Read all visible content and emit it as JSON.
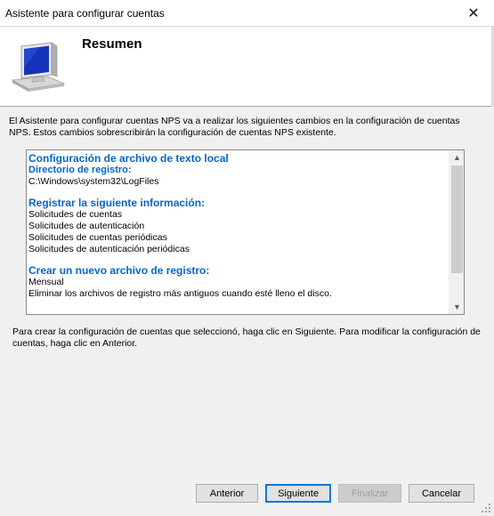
{
  "window": {
    "title": "Asistente para configurar cuentas",
    "close_glyph": "✕"
  },
  "header": {
    "heading": "Resumen",
    "icon": "computer-monitor-icon"
  },
  "intro": "El Asistente para configurar cuentas NPS va a realizar los siguientes cambios en la configuración de cuentas NPS. Estos cambios sobrescribirán la configuración de cuentas NPS existente.",
  "summary": {
    "section_title": "Configuración de archivo de texto local",
    "log_dir_label": "Directorio de registro:",
    "log_dir_value": "C:\\Windows\\system32\\LogFiles",
    "log_info_label": "Registrar la siguiente información:",
    "log_info_items": [
      "Solicitudes de cuentas",
      "Solicitudes de autenticación",
      "Solicitudes de cuentas periódicas",
      "Solicitudes de autenticación periódicas"
    ],
    "new_file_label": "Crear un nuevo archivo de registro:",
    "new_file_items": [
      "Mensual",
      "Eliminar los archivos de registro más antiguos cuando esté lleno el disco."
    ]
  },
  "footer_text": "Para crear la configuración de cuentas que seleccionó, haga clic en Siguiente. Para modificar la configuración de cuentas, haga clic en Anterior.",
  "buttons": {
    "back": "Anterior",
    "next": "Siguiente",
    "finish": "Finalizar",
    "cancel": "Cancelar"
  }
}
